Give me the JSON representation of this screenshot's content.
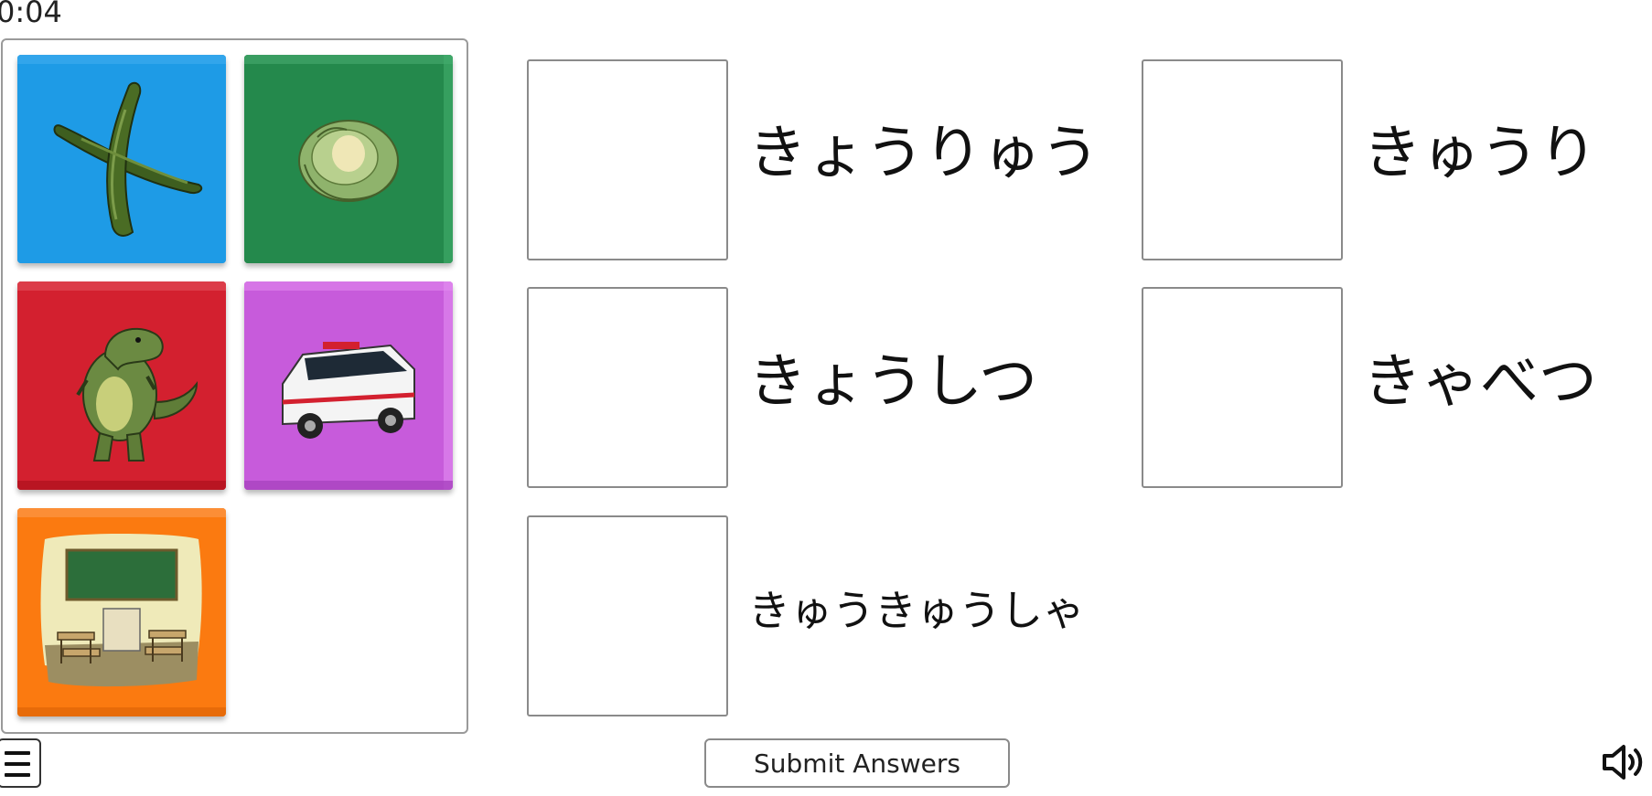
{
  "timer": {
    "text": "0:04"
  },
  "picture_cards": [
    {
      "subject": "cucumber",
      "bg_color": "#1e9be6"
    },
    {
      "subject": "cabbage",
      "bg_color": "#24894c"
    },
    {
      "subject": "dinosaur",
      "bg_color": "#d3202f"
    },
    {
      "subject": "ambulance",
      "bg_color": "#c75bdb"
    },
    {
      "subject": "classroom",
      "bg_color": "#fb7a10"
    }
  ],
  "words": [
    {
      "text": "きょうりゅう"
    },
    {
      "text": "きゅうり"
    },
    {
      "text": "きょうしつ"
    },
    {
      "text": "きゃべつ"
    },
    {
      "text": "きゅうきゅうしゃ"
    }
  ],
  "controls": {
    "menu_icon": "hamburger-menu-icon",
    "submit_label": "Submit Answers",
    "sound_icon": "speaker-volume-icon"
  }
}
